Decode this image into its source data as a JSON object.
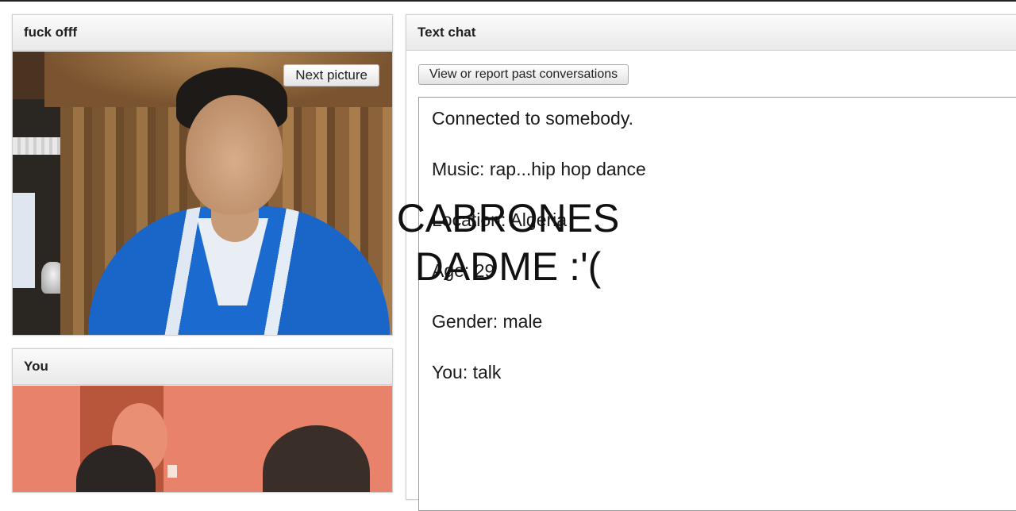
{
  "stranger_panel": {
    "title": "fuck offf",
    "next_picture_label": "Next picture"
  },
  "you_panel": {
    "title": "You"
  },
  "chat_panel": {
    "title": "Text chat",
    "view_report_label": "View or report past conversations",
    "log": [
      "Connected to somebody.",
      "Music: rap...hip hop dance",
      "Location: Algeria",
      "Age: 29",
      "Gender: male",
      "You: talk"
    ]
  },
  "overlay_caption": {
    "line1": "CABRONES",
    "line2": "DADME :'("
  }
}
